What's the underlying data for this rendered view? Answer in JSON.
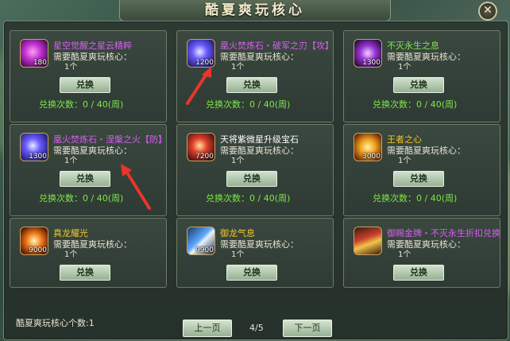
{
  "window": {
    "title": "酷夏爽玩核心",
    "close_glyph": "✕"
  },
  "colors": {
    "purple": "#d95df2",
    "yellow": "#f2c428",
    "green": "#7fe64a",
    "white": "#e9e4d2"
  },
  "cards": [
    {
      "name": "星空觉醒之星云精粹",
      "name_color": "#d95df2",
      "icon": "purple-crystal-icon",
      "count": "180",
      "requirement": "需要酷夏爽玩核心：",
      "req_value": "1个",
      "button": "兑换",
      "exchange": "兑换次数：0 / 40(周)"
    },
    {
      "name": "凰火焚炼石・破军之刃【攻】",
      "name_color": "#d95df2",
      "icon": "blue-orb-icon",
      "count": "1200",
      "requirement": "需要酷夏爽玩核心：",
      "req_value": "1个",
      "button": "兑换",
      "exchange": "兑换次数：0 / 40(周)"
    },
    {
      "name": "不灭永生之息",
      "name_color": "#7fe64a",
      "icon": "violet-orb-icon",
      "count": "1300",
      "requirement": "需要酷夏爽玩核心：",
      "req_value": "1个",
      "button": "兑换",
      "exchange": "兑换次数：0 / 40(周)"
    },
    {
      "name": "凰火焚炼石・涅槃之火【防】",
      "name_color": "#d95df2",
      "icon": "blue-orb-icon",
      "count": "1300",
      "requirement": "需要酷夏爽玩核心：",
      "req_value": "1个",
      "button": "兑换",
      "exchange": "兑换次数：0 / 40(周)"
    },
    {
      "name": "天将紫微星升级宝石",
      "name_color": "#ffffff",
      "icon": "red-gem-icon",
      "count": "7200",
      "requirement": "需要酷夏爽玩核心：",
      "req_value": "1个",
      "button": "兑换",
      "exchange": "兑换次数：0 / 40(周)"
    },
    {
      "name": "王者之心",
      "name_color": "#f2c428",
      "icon": "gold-heart-icon",
      "count": "3000",
      "requirement": "需要酷夏爽玩核心：",
      "req_value": "1个",
      "button": "兑换",
      "exchange": "兑换次数：0 / 40(周)"
    },
    {
      "name": "真龙耀光",
      "name_color": "#f2c428",
      "icon": "fire-orb-icon",
      "count": "9000",
      "requirement": "需要酷夏爽玩核心：",
      "req_value": "1个",
      "button": "兑换",
      "exchange": ""
    },
    {
      "name": "御龙气息",
      "name_color": "#f2c428",
      "icon": "sword-icon",
      "count": "9900",
      "requirement": "需要酷夏爽玩核心：",
      "req_value": "1个",
      "button": "兑换",
      "exchange": ""
    },
    {
      "name": "御赐金牌・不灭永生折扣兑换",
      "name_color": "#d95df2",
      "icon": "gold-token-icon",
      "count": "",
      "requirement": "需要酷夏爽玩核心：",
      "req_value": "1个",
      "button": "兑换",
      "exchange": ""
    }
  ],
  "footer": {
    "core_count": "酷夏爽玩核心个数:1",
    "prev": "上一页",
    "page": "4/5",
    "next": "下一页"
  }
}
